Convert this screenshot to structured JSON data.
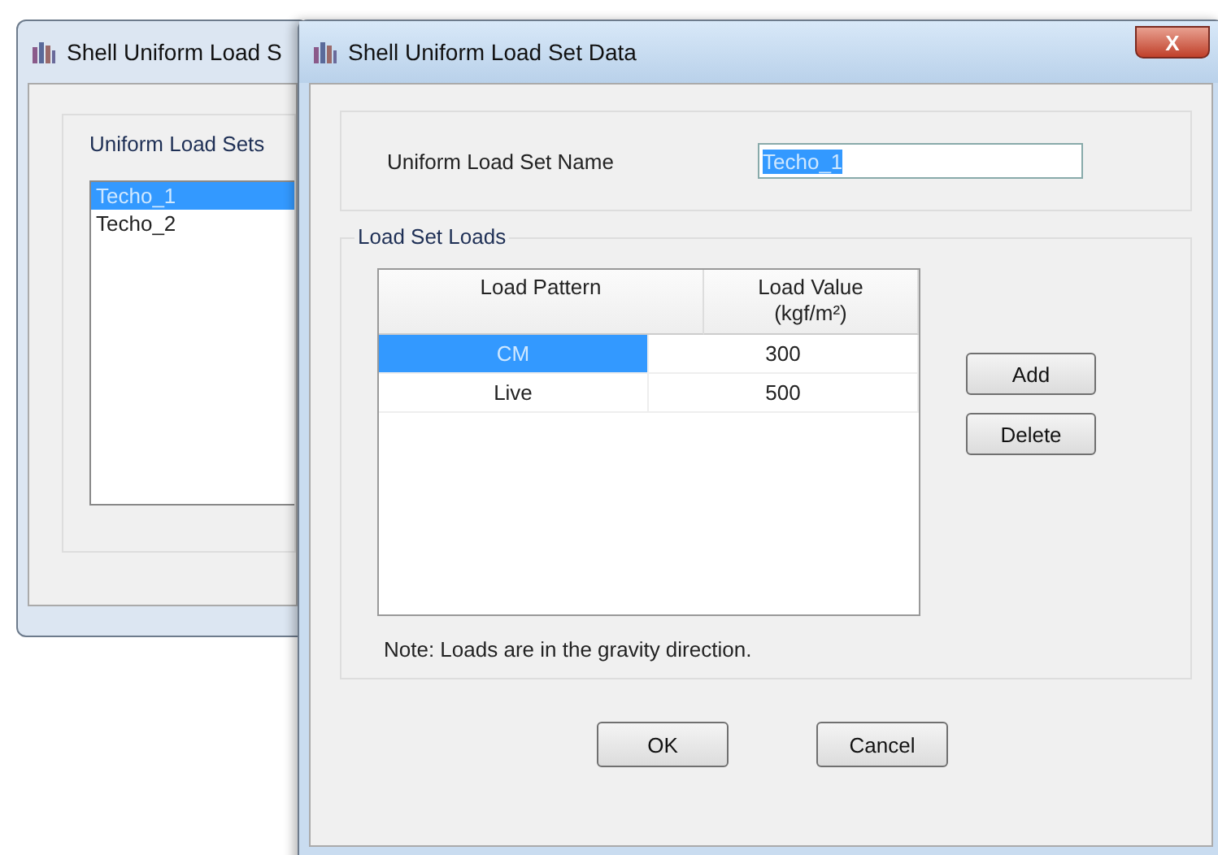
{
  "back_window": {
    "title": "Shell Uniform Load S",
    "group_label": "Uniform Load Sets",
    "list_items": [
      {
        "label": "Techo_1",
        "selected": true
      },
      {
        "label": "Techo_2",
        "selected": false
      }
    ]
  },
  "window": {
    "title": "Shell Uniform Load Set Data",
    "close": "X"
  },
  "name_field": {
    "label": "Uniform Load Set Name",
    "value": "Techo_1",
    "selected": true
  },
  "loads_group": {
    "label": "Load Set Loads",
    "table": {
      "columns": [
        "Load Pattern",
        "Load Value\n(kgf/m²)"
      ],
      "rows": [
        {
          "cells": [
            "CM",
            "300"
          ],
          "selected": true
        },
        {
          "cells": [
            "Live",
            "500"
          ],
          "selected": false
        }
      ]
    },
    "side_buttons": [
      "Add",
      "Delete"
    ],
    "note": "Note:  Loads are in the gravity direction."
  },
  "buttons": [
    "OK",
    "Cancel"
  ]
}
